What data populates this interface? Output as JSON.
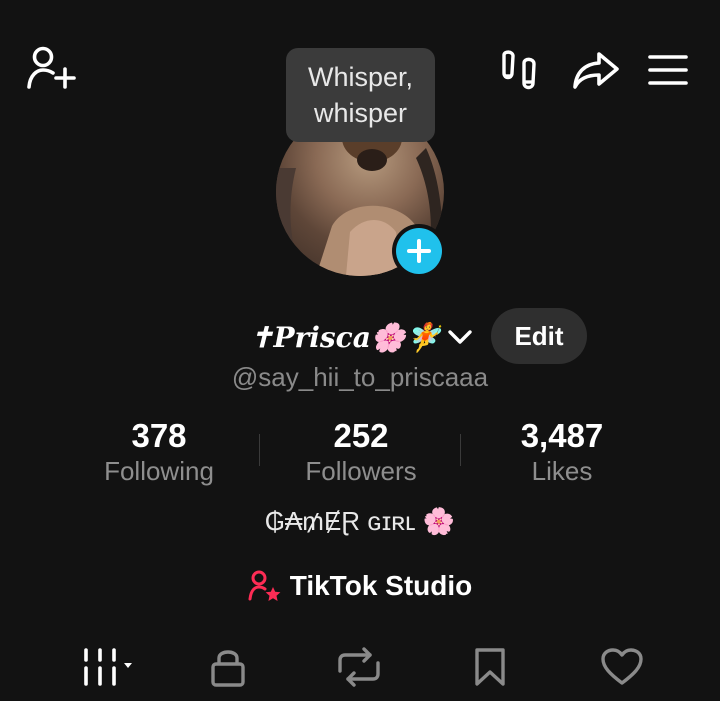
{
  "header": {
    "add_friend_icon": "person-plus-icon",
    "footprints_icon": "footprints-icon",
    "share_icon": "share-arrow-icon",
    "menu_icon": "hamburger-menu-icon"
  },
  "tooltip": {
    "line1": "Whisper,",
    "line2": "whisper"
  },
  "profile": {
    "display_name": "✝𝑷𝒓𝒊𝒔𝒄𝒂🌸🧚",
    "username": "@say_hii_to_priscaaa",
    "edit_label": "Edit",
    "bio": "₲₳₥ɆⱤ ɢɪʀʟ 🌸"
  },
  "stats": {
    "following": {
      "count": "378",
      "label": "Following"
    },
    "followers": {
      "count": "252",
      "label": "Followers"
    },
    "likes": {
      "count": "3,487",
      "label": "Likes"
    }
  },
  "studio": {
    "label": "TikTok Studio",
    "accent": "#fe2c55"
  },
  "tabs": [
    "videos-grid-icon",
    "lock-icon",
    "repost-icon",
    "bookmark-icon",
    "heart-icon"
  ],
  "colors": {
    "background": "#121212",
    "add_button": "#20c1ec",
    "secondary_text": "#8e8e8e"
  }
}
